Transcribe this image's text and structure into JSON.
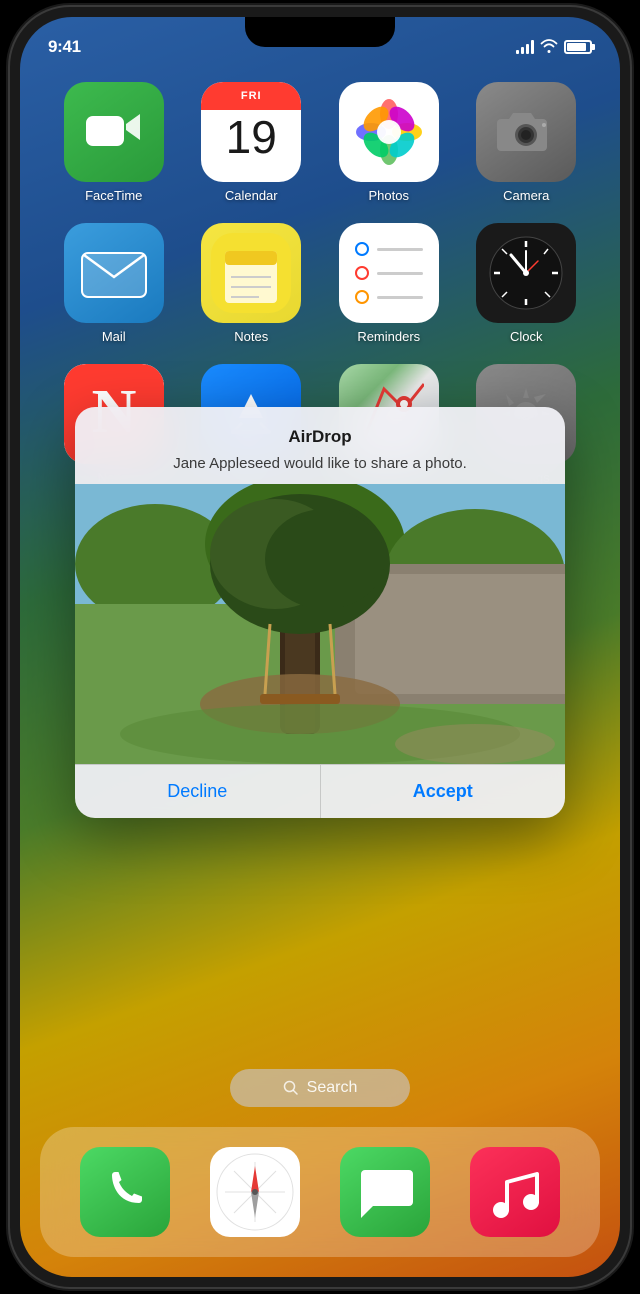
{
  "status_bar": {
    "time": "9:41",
    "signal_bars": 4,
    "wifi": true,
    "battery": 85
  },
  "apps": {
    "row1": [
      {
        "id": "facetime",
        "label": "FaceTime",
        "icon": "📹"
      },
      {
        "id": "calendar",
        "label": "Calendar",
        "day": "FRI",
        "date": "19"
      },
      {
        "id": "photos",
        "label": "Photos"
      },
      {
        "id": "camera",
        "label": "Camera",
        "icon": "📷"
      }
    ],
    "row2": [
      {
        "id": "mail",
        "label": "Mail"
      },
      {
        "id": "notes",
        "label": "Notes",
        "icon": "📝"
      },
      {
        "id": "reminders",
        "label": "Reminders"
      },
      {
        "id": "clock",
        "label": "Clock"
      }
    ],
    "row3": [
      {
        "id": "news",
        "label": "News"
      },
      {
        "id": "appstore",
        "label": "App Store"
      },
      {
        "id": "maps",
        "label": "Maps"
      },
      {
        "id": "settings",
        "label": "Settings"
      }
    ]
  },
  "airdrop": {
    "title": "AirDrop",
    "message": "Jane Appleseed would like to share a photo.",
    "decline_label": "Decline",
    "accept_label": "Accept"
  },
  "search": {
    "label": "Search"
  },
  "dock": [
    {
      "id": "phone",
      "icon": "📞"
    },
    {
      "id": "safari",
      "icon": "🧭"
    },
    {
      "id": "messages",
      "icon": "💬"
    },
    {
      "id": "music",
      "icon": "🎵"
    }
  ]
}
